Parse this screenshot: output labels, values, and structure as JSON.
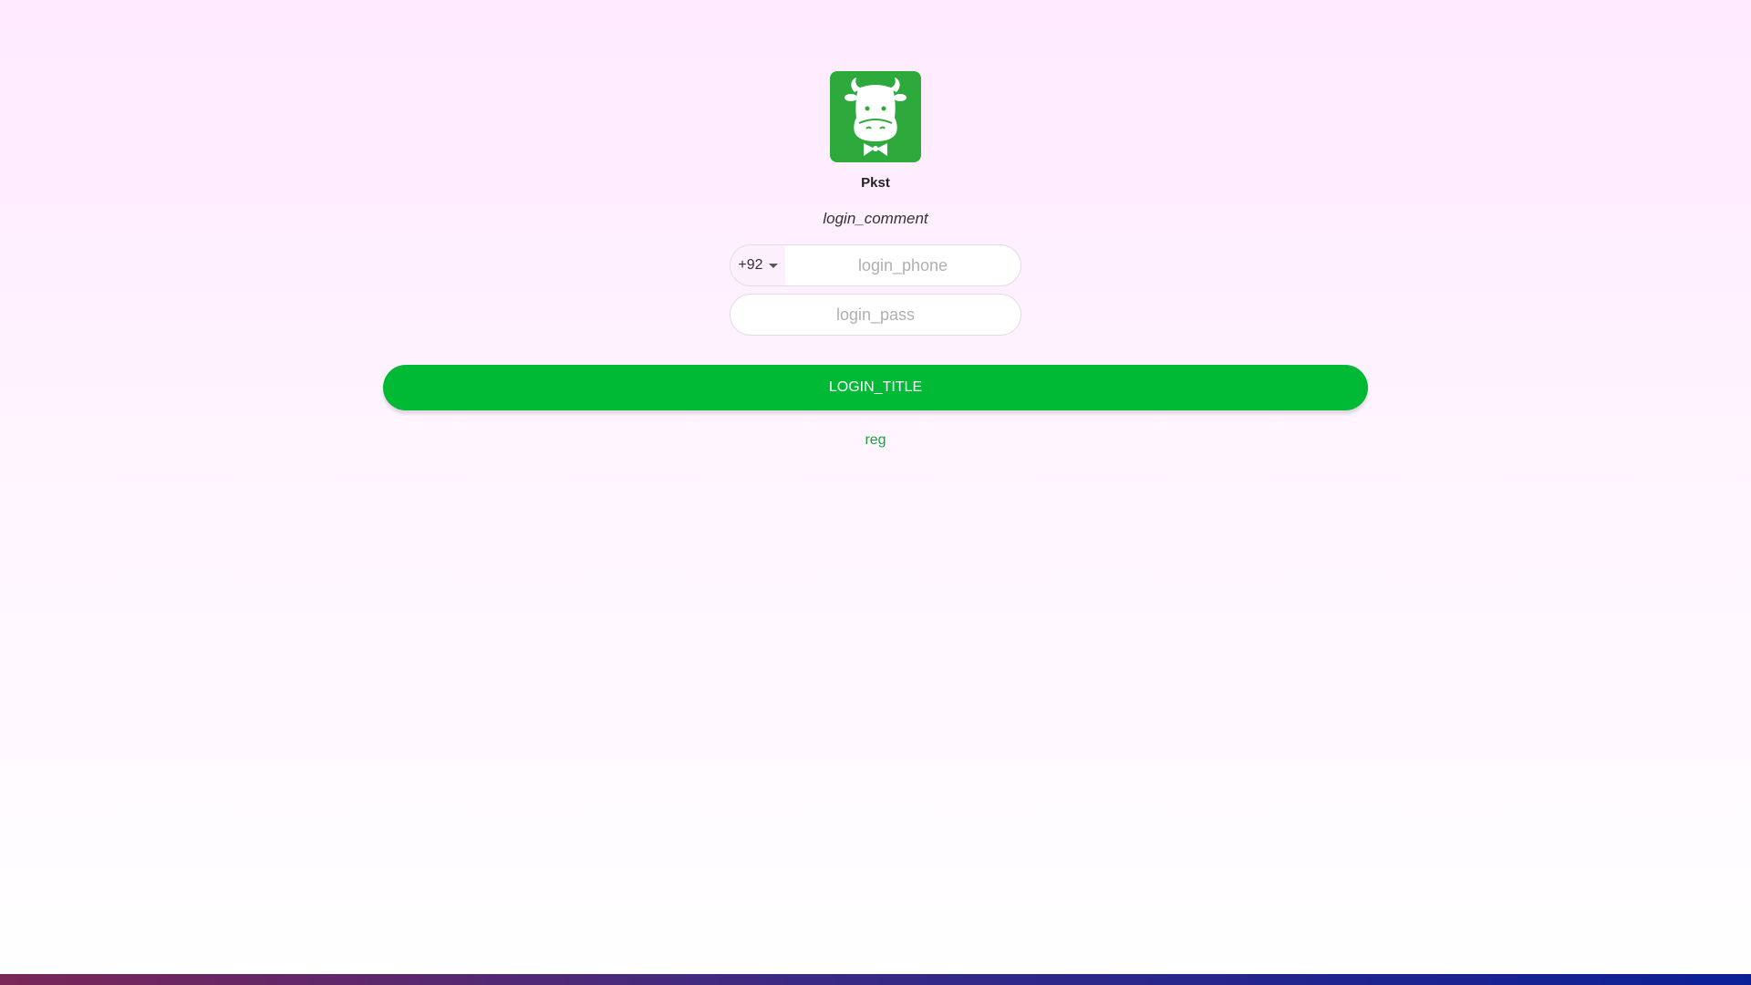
{
  "app": {
    "name": "Pkst",
    "logo_icon": "cow-logo-icon",
    "logo_color": "#2eaa3c"
  },
  "login": {
    "comment": "login_comment",
    "country_code": "+92",
    "phone_placeholder": "login_phone",
    "pass_placeholder": "login_pass",
    "button_label": "LOGIN_TITLE",
    "reg_label": "reg"
  },
  "colors": {
    "accent": "#00b935",
    "link": "#1aa33a"
  }
}
